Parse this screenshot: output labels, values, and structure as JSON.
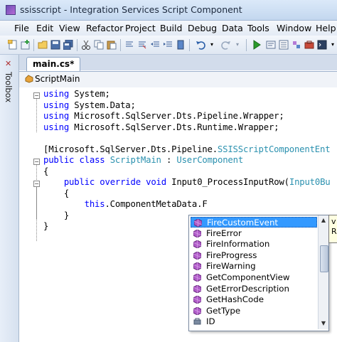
{
  "window": {
    "title": "ssisscript - Integration Services Script Component"
  },
  "menu": [
    "File",
    "Edit",
    "View",
    "Refactor",
    "Project",
    "Build",
    "Debug",
    "Data",
    "Tools",
    "Window",
    "Help"
  ],
  "toolbox": {
    "label": "Toolbox"
  },
  "tabs": [
    {
      "label": "main.cs*"
    }
  ],
  "nav": {
    "class_selector": "ScriptMain"
  },
  "code": {
    "lines": [
      [
        {
          "t": "using",
          "k": "kw"
        },
        {
          "t": " System;"
        }
      ],
      [
        {
          "t": "using",
          "k": "kw"
        },
        {
          "t": " System.Data;"
        }
      ],
      [
        {
          "t": "using",
          "k": "kw"
        },
        {
          "t": " Microsoft.SqlServer.Dts.Pipeline.Wrapper;"
        }
      ],
      [
        {
          "t": "using",
          "k": "kw"
        },
        {
          "t": " Microsoft.SqlServer.Dts.Runtime.Wrapper;"
        }
      ],
      [],
      [
        {
          "t": "[Microsoft.SqlServer.Dts.Pipeline."
        },
        {
          "t": "SSISScriptComponentEnt",
          "k": "ty"
        }
      ],
      [
        {
          "t": "public",
          "k": "kw"
        },
        {
          "t": " "
        },
        {
          "t": "class",
          "k": "kw"
        },
        {
          "t": " "
        },
        {
          "t": "ScriptMain",
          "k": "ty"
        },
        {
          "t": " : "
        },
        {
          "t": "UserComponent",
          "k": "ty"
        }
      ],
      [
        {
          "t": "{"
        }
      ],
      [
        {
          "t": "    "
        },
        {
          "t": "public",
          "k": "kw"
        },
        {
          "t": " "
        },
        {
          "t": "override",
          "k": "kw"
        },
        {
          "t": " "
        },
        {
          "t": "void",
          "k": "kw"
        },
        {
          "t": " Input0_ProcessInputRow("
        },
        {
          "t": "Input0Bu",
          "k": "ty"
        }
      ],
      [
        {
          "t": "    {"
        }
      ],
      [
        {
          "t": "        "
        },
        {
          "t": "this",
          "k": "kw"
        },
        {
          "t": ".ComponentMetaData.F"
        }
      ],
      [
        {
          "t": "    }"
        }
      ],
      [
        {
          "t": "}"
        }
      ]
    ]
  },
  "completion": {
    "selected": "FireCustomEvent",
    "items": [
      "FireCustomEvent",
      "FireError",
      "FireInformation",
      "FireProgress",
      "FireWarning",
      "GetComponentView",
      "GetErrorDescription",
      "GetHashCode",
      "GetType",
      "ID"
    ]
  },
  "tooltip": {
    "lines": [
      "v",
      "R"
    ]
  }
}
